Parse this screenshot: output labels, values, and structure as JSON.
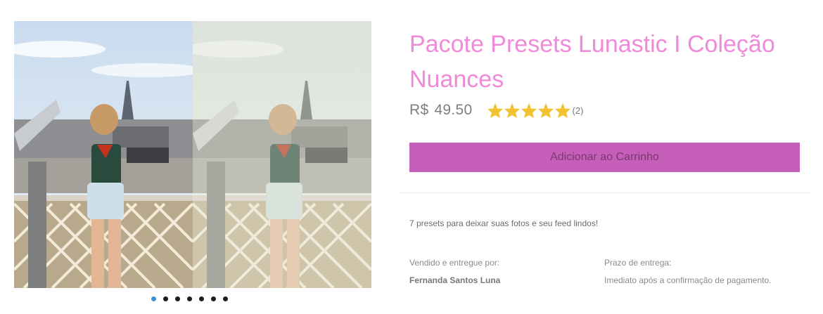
{
  "product": {
    "title": "Pacote Presets Lunastic I Coleção Nuances",
    "currency": "R$",
    "price": "49.50",
    "rating": 5,
    "rating_count": "(2)",
    "add_to_cart_label": "Adicionar ao Carrinho",
    "description": "7 presets para deixar suas fotos e seu feed lindos!"
  },
  "seller": {
    "label": "Vendido e entregue por:",
    "name": "Fernanda Santos Luna"
  },
  "delivery": {
    "label": "Prazo de entrega:",
    "value": "Imediato após a confirmação de pagamento."
  },
  "gallery": {
    "slide_count": 7,
    "active_index": 0
  },
  "colors": {
    "title": "#f08ad8",
    "button": "#c55fb9",
    "star": "#f1c232",
    "active_dot": "#3f8fd8"
  }
}
